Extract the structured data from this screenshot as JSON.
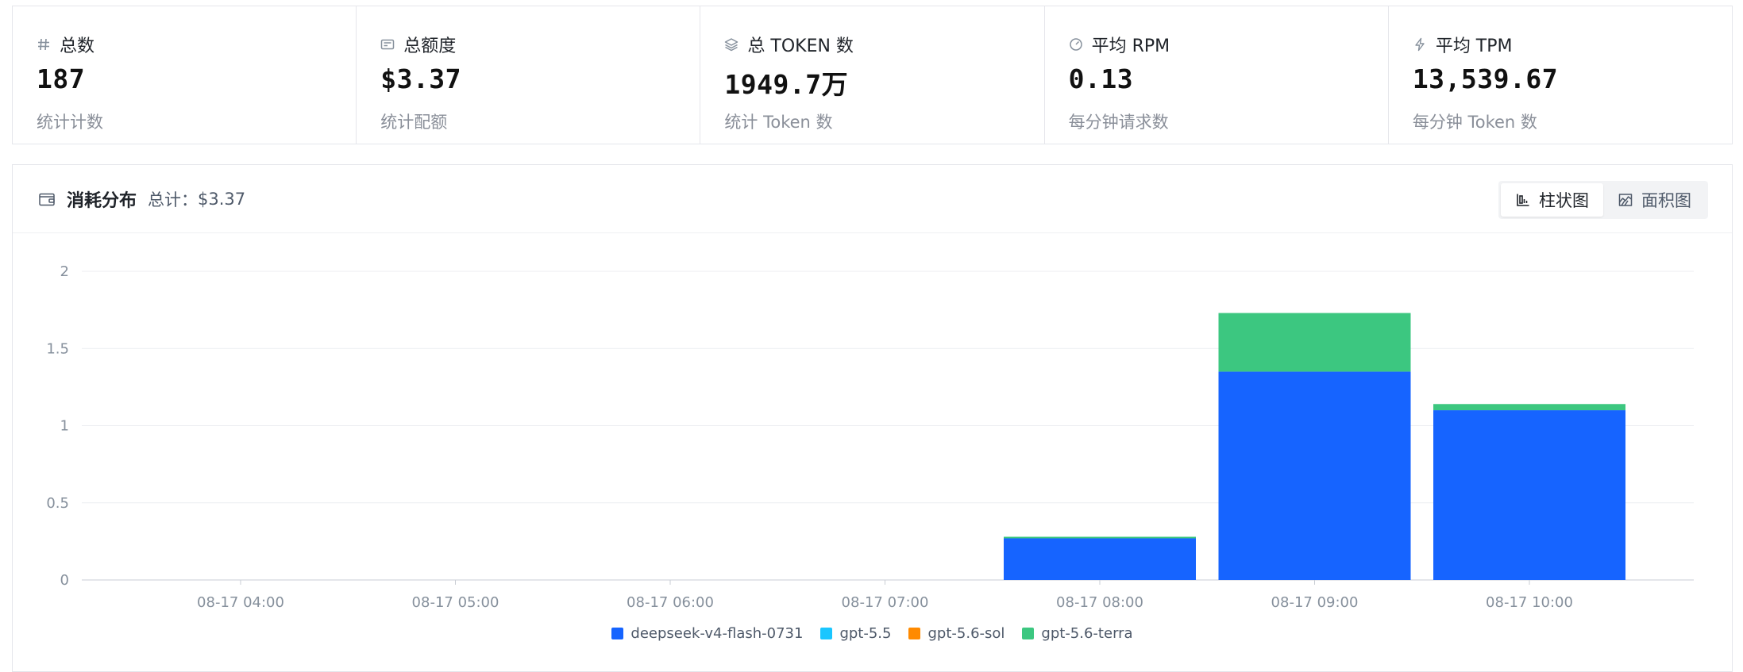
{
  "stats": [
    {
      "icon": "hash-icon",
      "title": "总数",
      "value": "187",
      "sub": "统计计数"
    },
    {
      "icon": "ticket-icon",
      "title": "总额度",
      "value": "$3.37",
      "sub": "统计配额"
    },
    {
      "icon": "layers-icon",
      "title": "总 TOKEN 数",
      "value": "1949.7万",
      "sub": "统计 Token 数"
    },
    {
      "icon": "gauge-icon",
      "title": "平均 RPM",
      "value": "0.13",
      "sub": "每分钟请求数"
    },
    {
      "icon": "bolt-icon",
      "title": "平均 TPM",
      "value": "13,539.67",
      "sub": "每分钟 Token 数"
    }
  ],
  "panel": {
    "icon": "wallet-icon",
    "title": "消耗分布",
    "total_label": "总计：",
    "total_value": "$3.37",
    "view_toggle": [
      {
        "icon": "bar-chart-icon",
        "label": "柱状图",
        "active": true
      },
      {
        "icon": "area-chart-icon",
        "label": "面积图",
        "active": false
      }
    ]
  },
  "colors": {
    "deepseek-v4-flash-0731": "#1664ff",
    "gpt-5.5": "#1ac6ff",
    "gpt-5.6-sol": "#ff8a00",
    "gpt-5.6-terra": "#3cc780"
  },
  "chart_data": {
    "type": "bar",
    "stacked": true,
    "categories": [
      "08-17 04:00",
      "08-17 05:00",
      "08-17 06:00",
      "08-17 07:00",
      "08-17 08:00",
      "08-17 09:00",
      "08-17 10:00"
    ],
    "series": [
      {
        "name": "deepseek-v4-flash-0731",
        "values": [
          0,
          0,
          0,
          0,
          0.27,
          1.35,
          1.1
        ]
      },
      {
        "name": "gpt-5.5",
        "values": [
          0,
          0,
          0,
          0,
          0,
          0,
          0
        ]
      },
      {
        "name": "gpt-5.6-sol",
        "values": [
          0,
          0,
          0,
          0,
          0,
          0,
          0
        ]
      },
      {
        "name": "gpt-5.6-terra",
        "values": [
          0,
          0,
          0,
          0,
          0.01,
          0.38,
          0.04
        ]
      }
    ],
    "yticks": [
      "0",
      "0.5",
      "1",
      "1.5",
      "2"
    ],
    "ylim": [
      0,
      2
    ],
    "grid": true,
    "legend_position": "bottom-center"
  }
}
